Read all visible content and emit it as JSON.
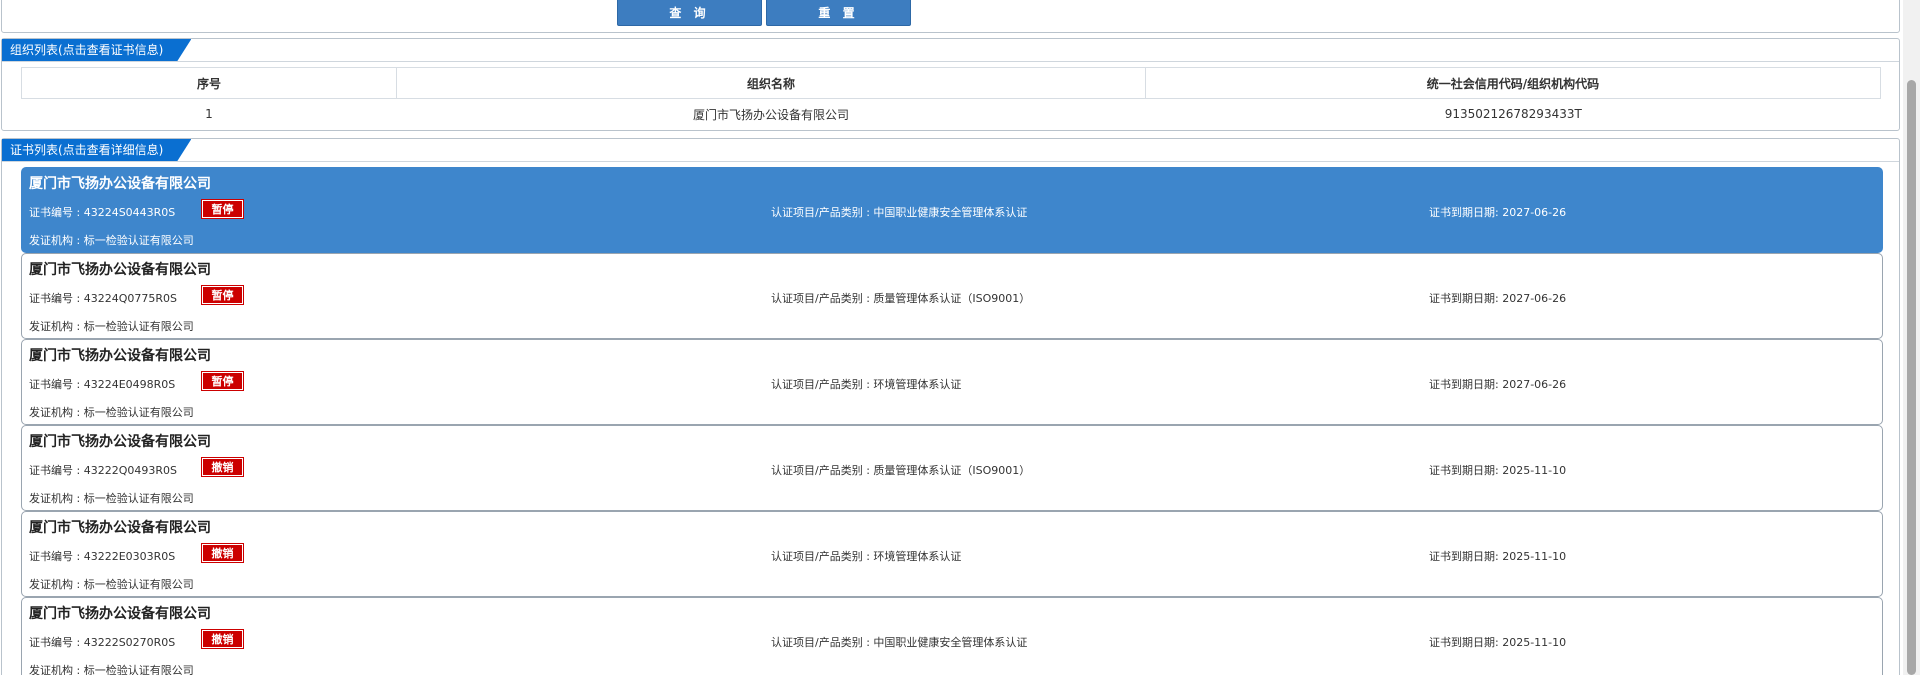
{
  "search": {
    "query_label": "查 询",
    "reset_label": "重 置"
  },
  "org_section": {
    "title": "组织列表(点击查看证书信息)",
    "columns": [
      "序号",
      "组织名称",
      "统一社会信用代码/组织机构代码"
    ],
    "rows": [
      {
        "index": "1",
        "name": "厦门市飞扬办公设备有限公司",
        "code": "91350212678293433T"
      }
    ]
  },
  "cert_section": {
    "title": "证书列表(点击查看详细信息)",
    "certs": [
      {
        "company": "厦门市飞扬办公设备有限公司",
        "number": "证书编号 : 43224S0443R0S",
        "status": "暂停",
        "project": "认证项目/产品类别 : 中国职业健康安全管理体系认证",
        "expiry": "证书到期日期: 2027-06-26",
        "issuer": "发证机构 : 标一检验认证有限公司"
      },
      {
        "company": "厦门市飞扬办公设备有限公司",
        "number": "证书编号 : 43224Q0775R0S",
        "status": "暂停",
        "project": "认证项目/产品类别 : 质量管理体系认证（ISO9001）",
        "expiry": "证书到期日期: 2027-06-26",
        "issuer": "发证机构 : 标一检验认证有限公司"
      },
      {
        "company": "厦门市飞扬办公设备有限公司",
        "number": "证书编号 : 43224E0498R0S",
        "status": "暂停",
        "project": "认证项目/产品类别 : 环境管理体系认证",
        "expiry": "证书到期日期: 2027-06-26",
        "issuer": "发证机构 : 标一检验认证有限公司"
      },
      {
        "company": "厦门市飞扬办公设备有限公司",
        "number": "证书编号 : 43222Q0493R0S",
        "status": "撤销",
        "project": "认证项目/产品类别 : 质量管理体系认证（ISO9001）",
        "expiry": "证书到期日期: 2025-11-10",
        "issuer": "发证机构 : 标一检验认证有限公司"
      },
      {
        "company": "厦门市飞扬办公设备有限公司",
        "number": "证书编号 : 43222E0303R0S",
        "status": "撤销",
        "project": "认证项目/产品类别 : 环境管理体系认证",
        "expiry": "证书到期日期: 2025-11-10",
        "issuer": "发证机构 : 标一检验认证有限公司"
      },
      {
        "company": "厦门市飞扬办公设备有限公司",
        "number": "证书编号 : 43222S0270R0S",
        "status": "撤销",
        "project": "认证项目/产品类别 : 中国职业健康安全管理体系认证",
        "expiry": "证书到期日期: 2025-11-10",
        "issuer": "发证机构 : 标一检验认证有限公司"
      }
    ]
  },
  "colors": {
    "primary_button": "#3d7dc0",
    "section_title": "#0a6fd1",
    "selected_card": "#3e86cc",
    "status_badge": "#cc0000"
  }
}
